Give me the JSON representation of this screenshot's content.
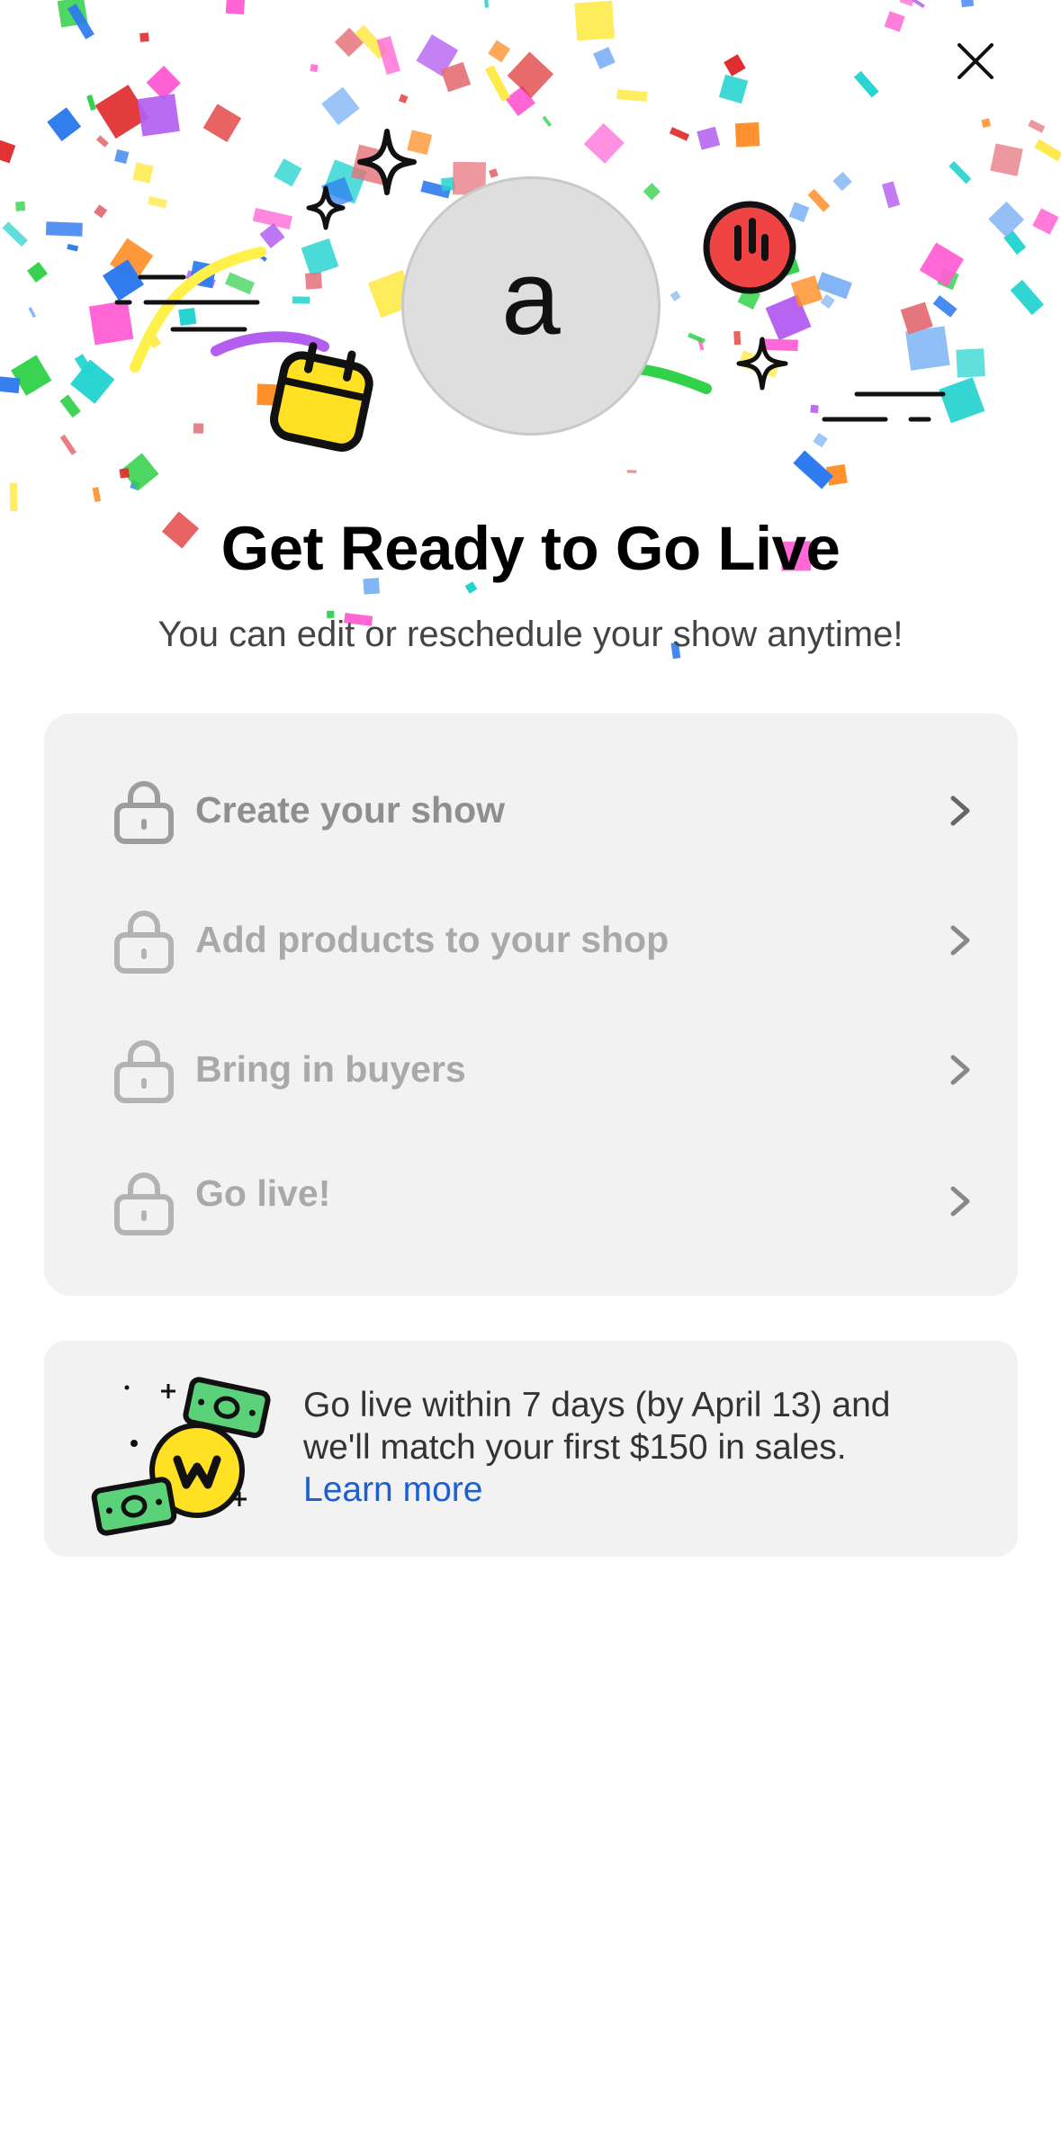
{
  "header": {
    "close_icon": "close-icon",
    "avatar_letter": "a"
  },
  "title": "Get Ready to Go Live",
  "subtitle": "You can edit or reschedule your show anytime!",
  "steps": [
    {
      "label": "Create your show",
      "icon": "lock-icon",
      "chevron": "chevron-right-icon"
    },
    {
      "label": "Add products to your shop",
      "icon": "lock-icon",
      "chevron": "chevron-right-icon"
    },
    {
      "label": "Bring in buyers",
      "icon": "lock-icon",
      "chevron": "chevron-right-icon"
    },
    {
      "label": "Go live!",
      "icon": "lock-icon",
      "chevron": "chevron-right-icon"
    }
  ],
  "promo": {
    "text": "Go live within 7 days (by April 13) and we'll match your first $150 in sales.",
    "link_label": "Learn more",
    "illustration": "money-coin-icon"
  },
  "colors": {
    "link": "#1a5fd4",
    "card_background": "#f2f2f2",
    "locked_text": "#a9a9a9"
  }
}
